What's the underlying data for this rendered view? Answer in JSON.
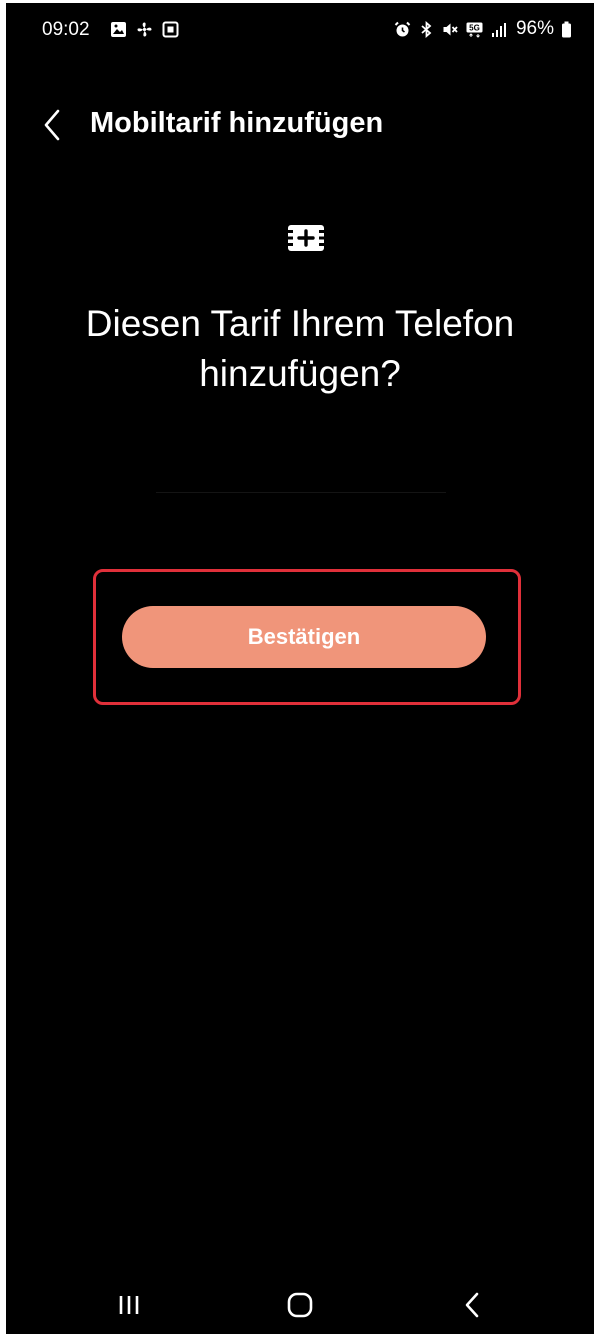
{
  "status_bar": {
    "time": "09:02",
    "left_icons": [
      "gallery-icon",
      "fan-icon",
      "screenshot-icon"
    ],
    "right_icons": [
      "alarm-icon",
      "bluetooth-icon",
      "mute-icon",
      "5g-icon",
      "signal-icon"
    ],
    "battery": "96%"
  },
  "header": {
    "back_icon": "chevron-left-icon",
    "title": "Mobiltarif hinzufügen"
  },
  "main": {
    "icon": "sim-add-icon",
    "headline": "Diesen Tarif Ihrem Telefon hinzufügen?",
    "confirm_label": "Bestätigen"
  },
  "colors": {
    "background": "#000000",
    "button": "#f0957a",
    "highlight": "#e0303a"
  },
  "nav_bar": {
    "icons": [
      "recents-icon",
      "home-icon",
      "back-icon"
    ]
  }
}
